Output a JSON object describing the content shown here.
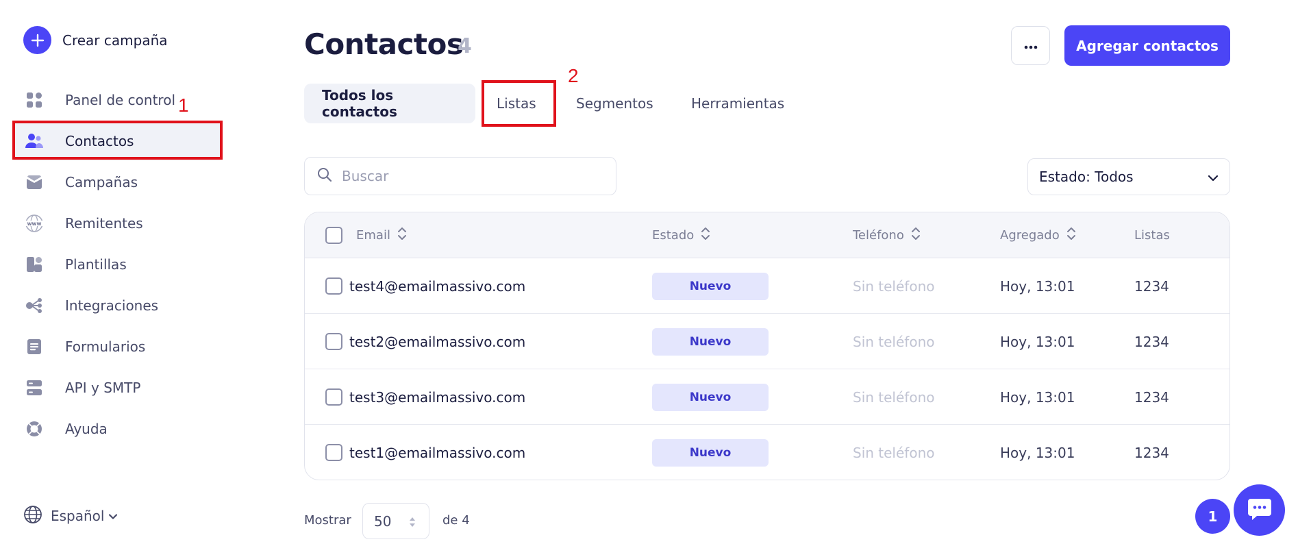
{
  "sidebar": {
    "create_label": "Crear campaña",
    "items": [
      {
        "label": "Panel de control",
        "icon": "dashboard-icon"
      },
      {
        "label": "Contactos",
        "icon": "contacts-icon",
        "active": true
      },
      {
        "label": "Campañas",
        "icon": "campaigns-icon"
      },
      {
        "label": "Remitentes",
        "icon": "senders-www-icon"
      },
      {
        "label": "Plantillas",
        "icon": "templates-icon"
      },
      {
        "label": "Integraciones",
        "icon": "integrations-icon"
      },
      {
        "label": "Formularios",
        "icon": "forms-icon"
      },
      {
        "label": "API y SMTP",
        "icon": "api-server-icon"
      },
      {
        "label": "Ayuda",
        "icon": "help-lifebuoy-icon"
      }
    ],
    "language": "Español"
  },
  "header": {
    "title": "Contactos",
    "count": "4",
    "more_label": "···",
    "add_label": "Agregar contactos"
  },
  "tabs": [
    {
      "label": "Todos los contactos",
      "active": true
    },
    {
      "label": "Listas"
    },
    {
      "label": "Segmentos"
    },
    {
      "label": "Herramientas"
    }
  ],
  "search": {
    "placeholder": "Buscar"
  },
  "filter": {
    "label": "Estado: Todos"
  },
  "table": {
    "columns": [
      "Email",
      "Estado",
      "Teléfono",
      "Agregado",
      "Listas"
    ],
    "rows": [
      {
        "email": "test4@emailmassivo.com",
        "status": "Nuevo",
        "phone": "Sin teléfono",
        "added": "Hoy, 13:01",
        "lists": "1234"
      },
      {
        "email": "test2@emailmassivo.com",
        "status": "Nuevo",
        "phone": "Sin teléfono",
        "added": "Hoy, 13:01",
        "lists": "1234"
      },
      {
        "email": "test3@emailmassivo.com",
        "status": "Nuevo",
        "phone": "Sin teléfono",
        "added": "Hoy, 13:01",
        "lists": "1234"
      },
      {
        "email": "test1@emailmassivo.com",
        "status": "Nuevo",
        "phone": "Sin teléfono",
        "added": "Hoy, 13:01",
        "lists": "1234"
      }
    ]
  },
  "footer": {
    "show_label": "Mostrar",
    "per_page": "50",
    "of_label": "de 4",
    "current_page": "1"
  },
  "annotations": {
    "one": "1",
    "two": "2"
  },
  "colors": {
    "accent": "#4b45f6",
    "annotation": "#e0121b",
    "badge_bg": "#e4e6fd"
  }
}
